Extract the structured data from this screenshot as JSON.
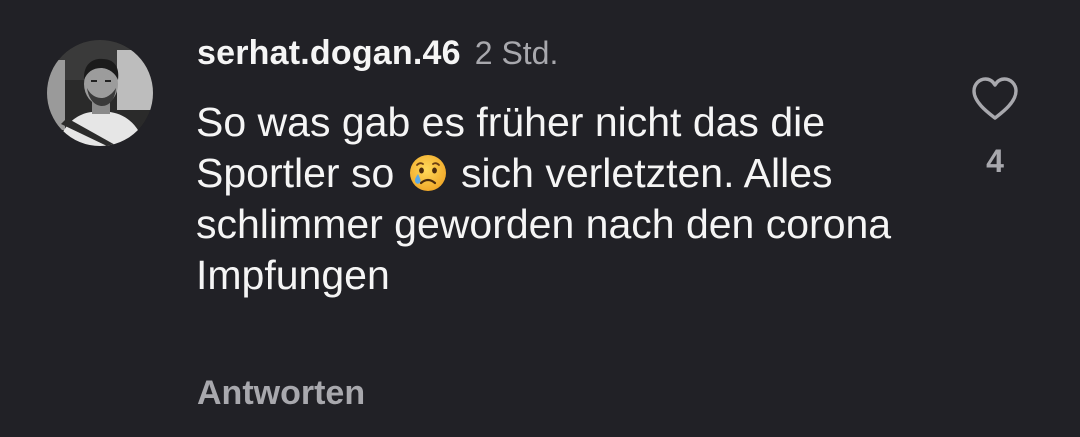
{
  "comment": {
    "username": "serhat.dogan.46",
    "timestamp": "2 Std.",
    "text_before_emoji": "So was gab es früher nicht das die Sportler so ",
    "emoji": "crying-face",
    "text_after_emoji": " sich verletzten. Alles schlimmer geworden nach den corona Impfungen",
    "reply_label": "Antworten",
    "like_icon": "heart-outline-icon",
    "like_count": "4"
  },
  "colors": {
    "background": "#212126",
    "primary_text": "#f5f5f5",
    "secondary_text": "#a8a8ad",
    "emoji_face": "#f5c33b",
    "emoji_tear": "#5aa9e6"
  }
}
